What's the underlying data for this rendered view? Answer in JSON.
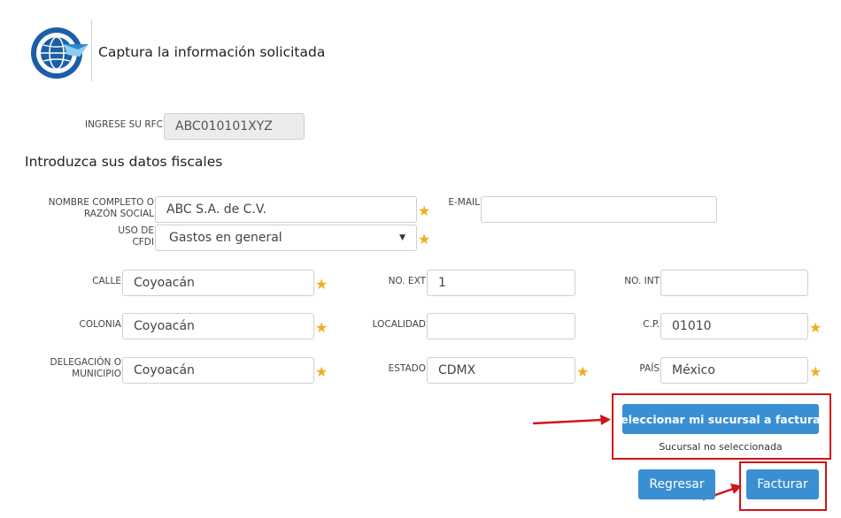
{
  "header": {
    "logo_icon": "globe-logo-icon",
    "title": "Captura la información solicitada"
  },
  "rfc": {
    "label": "INGRESE SU RFC",
    "value": "ABC010101XYZ"
  },
  "fiscal": {
    "title": "Introduzca sus datos fiscales",
    "nombre_label_1": "NOMBRE COMPLETO O",
    "nombre_label_2": "RAZÓN SOCIAL",
    "nombre_value": "ABC S.A. de C.V.",
    "email_label": "E-MAIL",
    "email_value": "",
    "uso_label_1": "USO DE",
    "uso_label_2": "CFDI",
    "uso_value": "Gastos en general",
    "calle_label": "CALLE",
    "calle_value": "Coyoacán",
    "noext_label": "NO. EXT",
    "noext_value": "1",
    "noint_label": "NO. INT",
    "noint_value": "",
    "colonia_label": "COLONIA",
    "colonia_value": "Coyoacán",
    "localidad_label": "LOCALIDAD",
    "localidad_value": "",
    "cp_label": "C.P.",
    "cp_value": "01010",
    "delegacion_label_1": "DELEGACIÓN O",
    "delegacion_label_2": "MUNICIPIO",
    "delegacion_value": "Coyoacán",
    "estado_label": "ESTADO",
    "estado_value": "CDMX",
    "pais_label": "PAÍS",
    "pais_value": "México",
    "required_mark": "★"
  },
  "sucursal": {
    "button_label": "Seleccionar mi sucursal a facturar.",
    "status": "Sucursal no seleccionada"
  },
  "actions": {
    "back_label": "Regresar",
    "invoice_label": "Facturar"
  },
  "colors": {
    "accent": "#3a8fd3",
    "required": "#f0ad1c",
    "annotation": "#d0141a"
  }
}
